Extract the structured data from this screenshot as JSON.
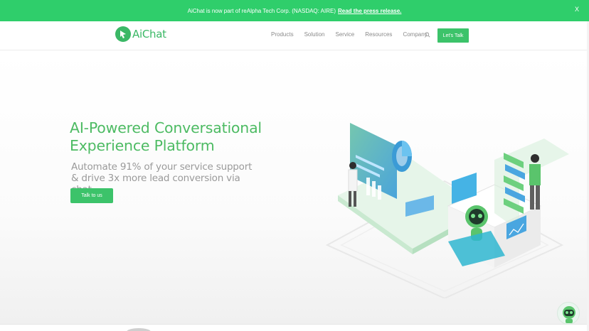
{
  "announcement": {
    "text": "AiChat is now part of reAlpha Tech Corp. (NASDAQ: AIRE)",
    "link": "Read the press release.",
    "close": "X"
  },
  "header": {
    "logo_text": "AiChat",
    "nav": [
      "Products",
      "Solution",
      "Service",
      "Resources",
      "Company"
    ],
    "cta": "Let's Talk"
  },
  "hero": {
    "title": "AI-Powered Conversational Experience Platform",
    "subtitle": "Automate 91% of your service support & drive 3x more lead conversion via chat",
    "button": "Talk to us"
  },
  "colors": {
    "brand": "#3cc36a",
    "announce_bg": "#2fce6b",
    "title": "#4dbb63"
  },
  "icons": [
    "search-icon",
    "robot-icon",
    "logo-icon"
  ]
}
